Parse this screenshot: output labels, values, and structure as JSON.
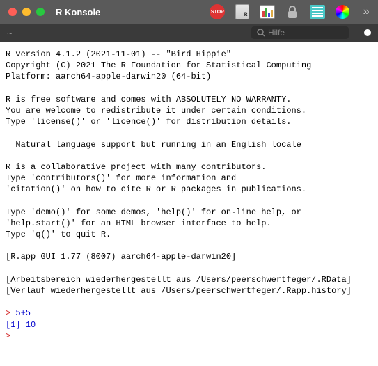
{
  "window": {
    "title": "R Konsole",
    "path": "~"
  },
  "search": {
    "placeholder": "Hilfe"
  },
  "toolbar": {
    "stop_label": "STOP"
  },
  "console": {
    "line1": "R version 4.1.2 (2021-11-01) -- \"Bird Hippie\"",
    "line2": "Copyright (C) 2021 The R Foundation for Statistical Computing",
    "line3": "Platform: aarch64-apple-darwin20 (64-bit)",
    "line4": "R is free software and comes with ABSOLUTELY NO WARRANTY.",
    "line5": "You are welcome to redistribute it under certain conditions.",
    "line6": "Type 'license()' or 'licence()' for distribution details.",
    "line7": "  Natural language support but running in an English locale",
    "line8": "R is a collaborative project with many contributors.",
    "line9": "Type 'contributors()' for more information and",
    "line10": "'citation()' on how to cite R or R packages in publications.",
    "line11": "Type 'demo()' for some demos, 'help()' for on-line help, or",
    "line12": "'help.start()' for an HTML browser interface to help.",
    "line13": "Type 'q()' to quit R.",
    "line14": "[R.app GUI 1.77 (8007) aarch64-apple-darwin20]",
    "line15": "[Arbeitsbereich wiederhergestellt aus /Users/peerschwertfeger/.RData]",
    "line16": "[Verlauf wiederhergestellt aus /Users/peerschwertfeger/.Rapp.history]",
    "prompt": "> ",
    "input1": "5+5",
    "output1": "[1] 10",
    "prompt2": ">"
  }
}
